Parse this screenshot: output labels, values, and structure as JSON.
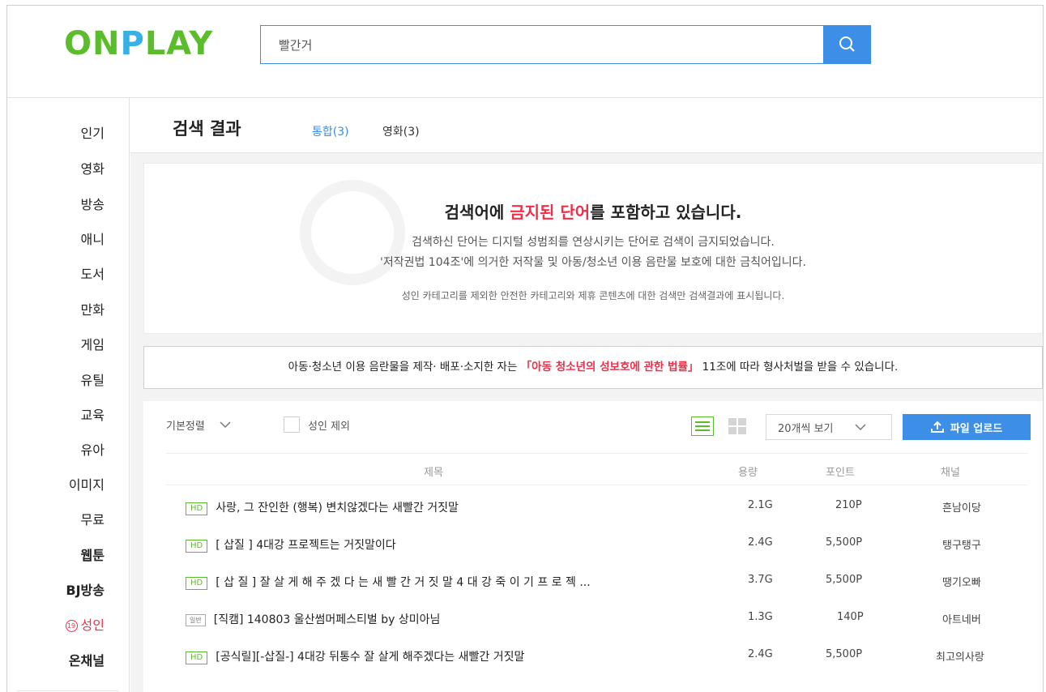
{
  "header": {
    "logo": "ONPLAY",
    "search": {
      "value": "빨간거",
      "placeholder": ""
    }
  },
  "sidebar": {
    "items": [
      {
        "label": "인기"
      },
      {
        "label": "영화"
      },
      {
        "label": "방송"
      },
      {
        "label": "애니"
      },
      {
        "label": "도서"
      },
      {
        "label": "만화"
      },
      {
        "label": "게임"
      },
      {
        "label": "유틸"
      },
      {
        "label": "교육"
      },
      {
        "label": "유아"
      },
      {
        "label": "이미지"
      },
      {
        "label": "무료"
      },
      {
        "label": "웹툰"
      },
      {
        "label": "BJ방송"
      },
      {
        "label": "성인",
        "badge": "19"
      },
      {
        "label": "온채널"
      }
    ]
  },
  "results": {
    "title": "검색 결과",
    "tabs": [
      {
        "label": "통합(3)",
        "active": true
      },
      {
        "label": "영화(3)",
        "active": false
      }
    ]
  },
  "warning": {
    "heading_pre": "검색어에 ",
    "heading_highlight": "금지된 단어",
    "heading_post": "를 포함하고 있습니다.",
    "line1": "검색하신 단어는 디지털 성범죄를 연상시키는 단어로 검색이 금지되었습니다.",
    "line2": "'저작권법 104조'에 의거한 저작물 및 아동/청소년 이용 음란물 보호에 대한 금칙어입니다.",
    "note": "성인 카테고리를 제외한 안전한 카테고리와 제휴 콘텐츠에 대한 검색만 검색결과에 표시됩니다."
  },
  "legal": {
    "pre": "아동·청소년 이용 음란물을 제작· 배포·소지한 자는",
    "law": "「아동 청소년의 성보호에 관한 법률」",
    "post": "11조에 따라 형사처벌을 받을 수 있습니다."
  },
  "toolbar": {
    "sort": "기본정렬",
    "adult_exclude": "성인 제외",
    "per_page": "20개씩 보기",
    "upload": "파일 업로드"
  },
  "table": {
    "columns": [
      "제목",
      "용량",
      "포인트",
      "채널"
    ],
    "rows": [
      {
        "badge": "HD",
        "title": "사랑, 그 잔인한 (행복) 변치않겠다는 새빨간 거짓말",
        "size": "2.1G",
        "points": "210P",
        "channel": "흔남이당"
      },
      {
        "badge": "HD",
        "title": "[ 삽질 ] 4대강 프로젝트는 거짓말이다",
        "size": "2.4G",
        "points": "5,500P",
        "channel": "탱구탱구"
      },
      {
        "badge": "HD",
        "title": "[ 삽 질 ] 잘 살 게 해 주 겠 다 는 새 빨 간 거 짓 말 4 대 강 죽 이 기 프 로 젝 ...",
        "size": "3.7G",
        "points": "5,500P",
        "channel": "땡기오빠"
      },
      {
        "badge": "일반",
        "title": "[직캠] 140803 울산썸머페스티벌 by 상미아님",
        "size": "1.3G",
        "points": "140P",
        "channel": "아트네버"
      },
      {
        "badge": "HD",
        "title": "[공식릴][-삽질-] 4대강 뒤통수 잘 살게 해주겠다는 새빨간 거짓말",
        "size": "2.4G",
        "points": "5,500P",
        "channel": "최고의사랑"
      }
    ]
  },
  "colors": {
    "brand_green": "#5bbd2b",
    "accent_blue": "#3d8ee6",
    "warning_red": "#ee2f4a"
  }
}
